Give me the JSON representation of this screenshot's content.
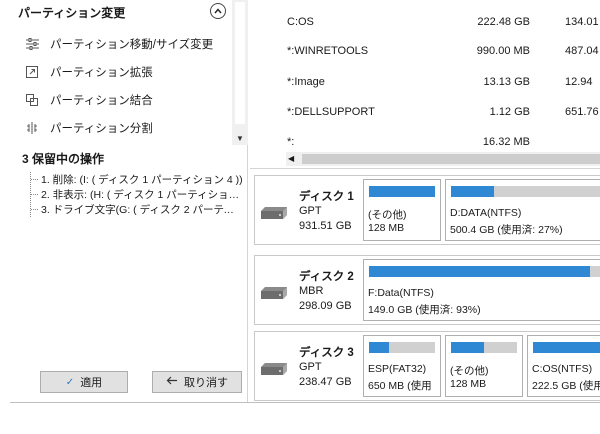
{
  "sidebar": {
    "header": "パーティション変更",
    "collapse_icon": "chevron-up-icon",
    "items": [
      {
        "label": "パーティション移動/サイズ変更",
        "icon": "resize-icon"
      },
      {
        "label": "パーティション拡張",
        "icon": "extend-icon"
      },
      {
        "label": "パーティション結合",
        "icon": "merge-icon"
      },
      {
        "label": "パーティション分割",
        "icon": "split-icon"
      }
    ],
    "pending_title": "3 保留中の操作",
    "pending": [
      "1. 削除: (I: ( ディスク 1 パーティション 4 ))",
      "2. 非表示: (H: ( ディスク 1 パーティション ...",
      "3. ドライブ文字(G: ( ディスク 2 パーティショ..."
    ],
    "apply_label": "適用",
    "undo_label": "取り消す"
  },
  "partition_list": [
    {
      "name": "C:OS",
      "capacity": "222.48 GB",
      "used": "134.01"
    },
    {
      "name": "*:WINRETOOLS",
      "capacity": "990.00 MB",
      "used": "487.04"
    },
    {
      "name": "*:Image",
      "capacity": "13.13 GB",
      "used": "12.94"
    },
    {
      "name": "*:DELLSUPPORT",
      "capacity": "1.12 GB",
      "used": "651.76"
    },
    {
      "name": "*:",
      "capacity": "16.32 MB",
      "used": ""
    }
  ],
  "disks": [
    {
      "name": "ディスク 1",
      "type": "GPT",
      "size": "931.51 GB",
      "partitions": [
        {
          "label": "(その他)",
          "size": "128 MB",
          "fill": 1.0
        },
        {
          "label": "D:DATA(NTFS)",
          "size": "500.4 GB (使用済: 27%)",
          "fill": 0.27
        }
      ]
    },
    {
      "name": "ディスク 2",
      "type": "MBR",
      "size": "298.09 GB",
      "partitions": [
        {
          "label": "F:Data(NTFS)",
          "size": "149.0 GB (使用済: 93%)",
          "fill": 0.93
        }
      ]
    },
    {
      "name": "ディスク 3",
      "type": "GPT",
      "size": "238.47 GB",
      "partitions": [
        {
          "label": "ESP(FAT32)",
          "size": "650 MB (使用",
          "fill": 0.3
        },
        {
          "label": "(その他)",
          "size": "128 MB",
          "fill": 0.5
        },
        {
          "label": "C:OS(NTFS)",
          "size": "222.5 GB (使用",
          "fill": 1.0
        }
      ]
    }
  ],
  "colors": {
    "accent": "#2e88d4",
    "bar_bg": "#d0d0d0"
  }
}
